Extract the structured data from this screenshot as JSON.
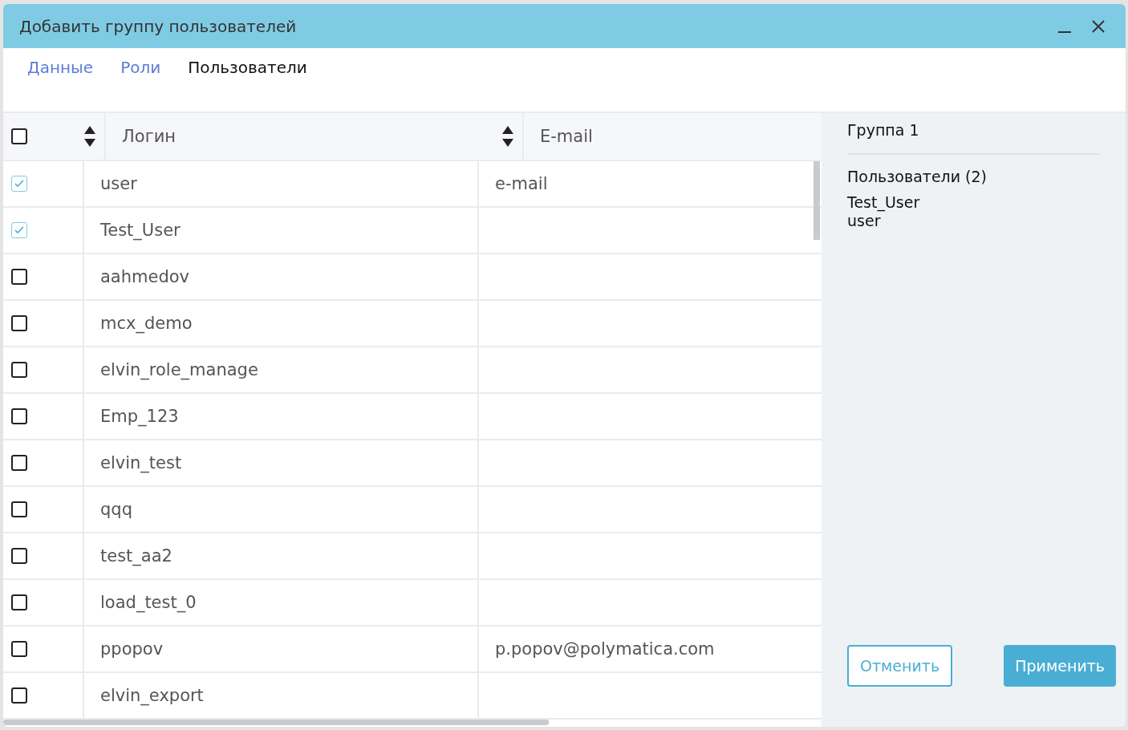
{
  "window": {
    "title": "Добавить группу пользователей"
  },
  "tabs": [
    {
      "label": "Данные",
      "selected": false
    },
    {
      "label": "Роли",
      "selected": false
    },
    {
      "label": "Пользователи",
      "selected": true
    }
  ],
  "table": {
    "select_all_checked": false,
    "columns": [
      "Логин",
      "E-mail"
    ],
    "rows": [
      {
        "login": "user",
        "email": "e-mail",
        "checked": true
      },
      {
        "login": "Test_User",
        "email": "",
        "checked": true
      },
      {
        "login": "aahmedov",
        "email": "",
        "checked": false
      },
      {
        "login": "mcx_demo",
        "email": "",
        "checked": false
      },
      {
        "login": "elvin_role_manage",
        "email": "",
        "checked": false
      },
      {
        "login": "Emp_123",
        "email": "",
        "checked": false
      },
      {
        "login": "elvin_test",
        "email": "",
        "checked": false
      },
      {
        "login": "qqq",
        "email": "",
        "checked": false
      },
      {
        "login": "test_aa2",
        "email": "",
        "checked": false
      },
      {
        "login": "load_test_0",
        "email": "",
        "checked": false
      },
      {
        "login": "ppopov",
        "email": "p.popov@polymatica.com",
        "checked": false
      },
      {
        "login": "elvin_export",
        "email": "",
        "checked": false
      }
    ]
  },
  "summary": {
    "group_name": "Группа 1",
    "users_heading": "Пользователи (2)",
    "users": [
      "Test_User",
      "user"
    ]
  },
  "buttons": {
    "cancel": "Отменить",
    "apply": "Применить"
  }
}
